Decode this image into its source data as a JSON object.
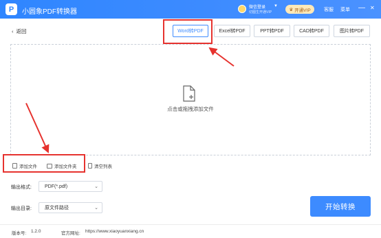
{
  "app": {
    "title": "小圆象PDF转换器",
    "logo_letter": "P"
  },
  "user": {
    "name": "微信登录",
    "subtitle": "切图生开通VIP"
  },
  "titlebar": {
    "vip_label": "开通VIP",
    "service_label": "客服",
    "menu_label": "菜单",
    "minimize": "—",
    "close": "✕"
  },
  "toolbar": {
    "back_label": "返回",
    "tabs": [
      {
        "label": "Word转PDF",
        "active": true
      },
      {
        "label": "Excel转PDF",
        "active": false
      },
      {
        "label": "PPT转PDF",
        "active": false
      },
      {
        "label": "CAD转PDF",
        "active": false
      },
      {
        "label": "图片转PDF",
        "active": false
      }
    ]
  },
  "dropzone": {
    "hint": "点击或拖拽添加文件"
  },
  "actions": {
    "add_file": "添加文件",
    "add_folder": "添加文件夹",
    "clear_list": "清空列表"
  },
  "settings": {
    "format_label": "输出格式:",
    "format_value": "PDF(*.pdf)",
    "dir_label": "输出目录:",
    "dir_value": "原文件路径"
  },
  "start_button": "开始转换",
  "footer": {
    "version_label": "版本号:",
    "version": "1.2.0",
    "site_label": "官方网址:",
    "site": "https://www.xiaoyuanxiang.cn"
  },
  "colors": {
    "accent": "#3d8bff",
    "annotation": "#e6322e"
  }
}
